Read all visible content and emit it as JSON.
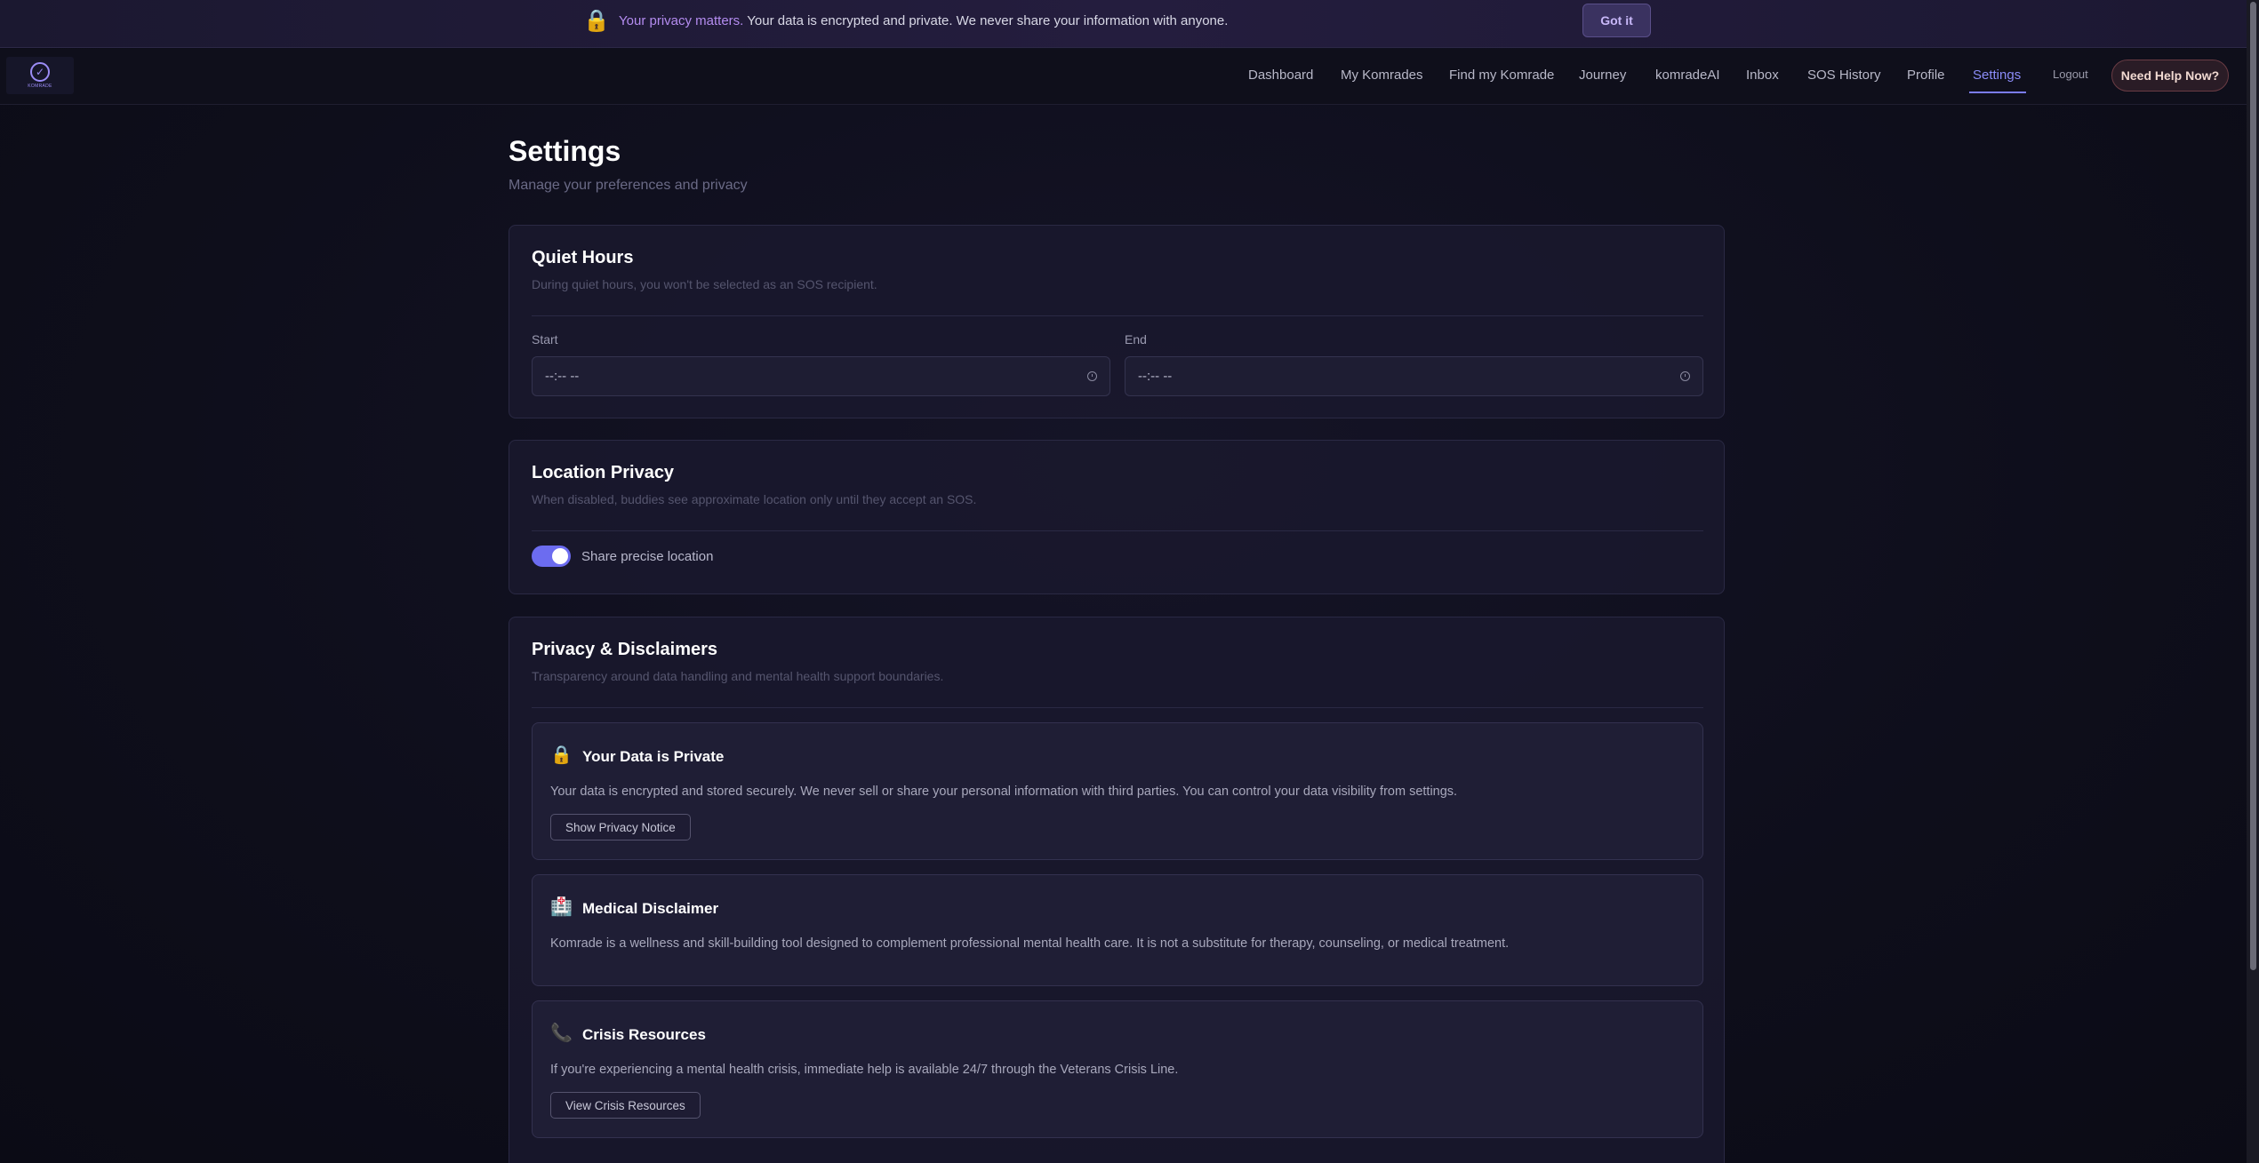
{
  "banner": {
    "icon": "lock-icon",
    "icon_glyph": "🔒",
    "strong": "Your privacy matters.",
    "text": "Your data is encrypted and private. We never share your information with anyone.",
    "button": "Got it"
  },
  "nav": {
    "logo_glyph": "✓",
    "logo_text": "KOMRADE",
    "items": [
      "Dashboard",
      "My Komrades",
      "Find my Komrade",
      "Journey",
      "komradeAI",
      "Inbox",
      "SOS History",
      "Profile",
      "Settings"
    ],
    "active": "Settings",
    "logout": "Logout",
    "help": "Need Help Now?"
  },
  "page": {
    "title": "Settings",
    "subtitle": "Manage your preferences and privacy"
  },
  "quiet_hours": {
    "title": "Quiet Hours",
    "description": "During quiet hours, you won't be selected as an SOS recipient.",
    "start_label": "Start",
    "start_value": "--:-- --",
    "end_label": "End",
    "end_value": "--:-- --"
  },
  "location_privacy": {
    "title": "Location Privacy",
    "description": "When disabled, buddies see approximate location only until they accept an SOS.",
    "toggle_label": "Share precise location",
    "toggle_on": true
  },
  "privacy_disclaimers": {
    "title": "Privacy & Disclaimers",
    "description": "Transparency around data handling and mental health support boundaries.",
    "data_private": {
      "icon_glyph": "🔒",
      "title": "Your Data is Private",
      "text": "Your data is encrypted and stored securely. We never sell or share your personal information with third parties. You can control your data visibility from settings.",
      "button": "Show Privacy Notice"
    },
    "medical": {
      "icon_glyph": "🏥",
      "title": "Medical Disclaimer",
      "text": "Komrade is a wellness and skill-building tool designed to complement professional mental health care. It is not a substitute for therapy, counseling, or medical treatment."
    },
    "crisis": {
      "icon_glyph": "📞",
      "title": "Crisis Resources",
      "text": "If you're experiencing a mental health crisis, immediate help is available 24/7 through the Veterans Crisis Line.",
      "button": "View Crisis Resources"
    }
  },
  "colors": {
    "accent": "#7b7cf5",
    "background": "#0e0e1a",
    "banner_highlight": "#b48cf0",
    "help_button_border": "#6a3c44"
  }
}
